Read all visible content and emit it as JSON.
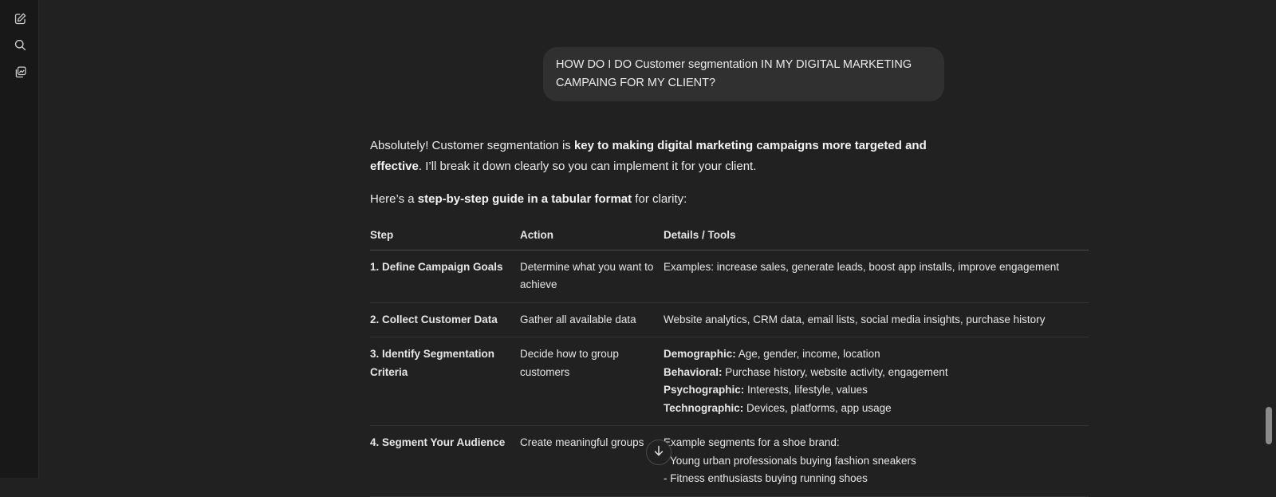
{
  "sidebar": {
    "icons": [
      "new-chat-icon",
      "search-icon",
      "library-icon"
    ]
  },
  "user_message": {
    "line1": "HOW DO I DO Customer segmentation IN MY DIGITAL MARKETING",
    "line2": "CAMPAING FOR MY CLIENT?"
  },
  "answer": {
    "intro_pre": "Absolutely! Customer segmentation is ",
    "intro_bold": "key to making digital marketing campaigns more targeted and effective",
    "intro_post": ". I’ll break it down clearly so you can implement it for your client.",
    "guide_pre": "Here’s a ",
    "guide_bold": "step-by-step guide in a tabular format",
    "guide_post": " for clarity:"
  },
  "table": {
    "headers": [
      "Step",
      "Action",
      "Details / Tools"
    ],
    "rows": [
      {
        "step": "1. Define Campaign Goals",
        "action": "Determine what you want to achieve",
        "details": "Examples: increase sales, generate leads, boost app installs, improve engagement"
      },
      {
        "step": "2. Collect Customer Data",
        "action": "Gather all available data",
        "details": "Website analytics, CRM data, email lists, social media insights, purchase history"
      },
      {
        "step": "3. Identify Segmentation Criteria",
        "action": "Decide how to group customers",
        "details_list": [
          {
            "label": "Demographic:",
            "text": " Age, gender, income, location"
          },
          {
            "label": "Behavioral:",
            "text": " Purchase history, website activity, engagement"
          },
          {
            "label": "Psychographic:",
            "text": " Interests, lifestyle, values"
          },
          {
            "label": "Technographic:",
            "text": " Devices, platforms, app usage"
          }
        ]
      },
      {
        "step": "4. Segment Your Audience",
        "action": "Create meaningful groups",
        "details_lines": [
          "Example segments for a shoe brand:",
          "- Young urban professionals buying fashion sneakers",
          "- Fitness enthusiasts buying running shoes"
        ]
      }
    ]
  },
  "colors": {
    "background": "#212121",
    "sidebar": "#181818",
    "bubble": "#303030",
    "text": "#ececec"
  }
}
